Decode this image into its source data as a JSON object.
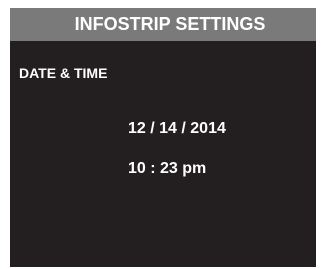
{
  "header": {
    "title": "INFOSTRIP SETTINGS"
  },
  "section": {
    "label": "DATE & TIME"
  },
  "datetime": {
    "date": "12 / 14 / 2014",
    "time": "10 : 23 pm"
  },
  "colors": {
    "screen_background": "#231f20",
    "title_bar_background": "#7a7a7a",
    "text": "#ffffff"
  }
}
